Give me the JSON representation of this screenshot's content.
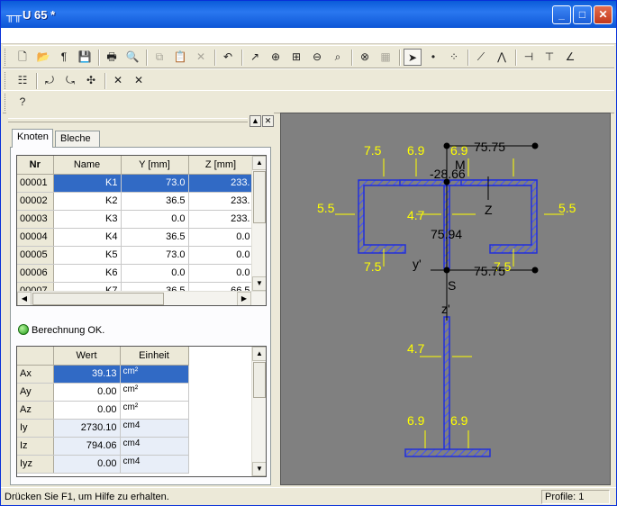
{
  "window": {
    "title": "U 65 *",
    "app_icon": "╥╥"
  },
  "toolbar1": [
    {
      "name": "new-icon",
      "glyph": "🗋"
    },
    {
      "name": "open-icon",
      "glyph": "📂"
    },
    {
      "name": "import-icon",
      "glyph": "¶"
    },
    {
      "name": "save-icon",
      "glyph": "💾"
    },
    {
      "name": "print-icon",
      "glyph": "🖶"
    },
    {
      "name": "print-preview-icon",
      "glyph": "🔍"
    },
    {
      "name": "copy-icon",
      "glyph": "⧉"
    },
    {
      "name": "paste-icon",
      "glyph": "📋"
    },
    {
      "name": "delete-icon",
      "glyph": "✕"
    },
    {
      "name": "undo-icon",
      "glyph": "↶"
    },
    {
      "name": "arrow-icon",
      "glyph": "↗"
    },
    {
      "name": "zoom-in-icon",
      "glyph": "⊕"
    },
    {
      "name": "zoom-window-icon",
      "glyph": "⊞"
    },
    {
      "name": "zoom-out-icon",
      "glyph": "⊖"
    },
    {
      "name": "zoom-fit-icon",
      "glyph": "⌕"
    },
    {
      "name": "zoom-select-icon",
      "glyph": "⊗"
    },
    {
      "name": "grid-view-icon",
      "glyph": "▦"
    },
    {
      "name": "select-pointer-icon",
      "glyph": "➤"
    },
    {
      "name": "node-icon",
      "glyph": "•"
    },
    {
      "name": "dot-grid-icon",
      "glyph": "⁘"
    },
    {
      "name": "line-icon",
      "glyph": "⟋"
    },
    {
      "name": "polyline-icon",
      "glyph": "⋀"
    },
    {
      "name": "dimension-h-icon",
      "glyph": "⊣"
    },
    {
      "name": "dimension-v-icon",
      "glyph": "⊤"
    },
    {
      "name": "dimension-angle-icon",
      "glyph": "∠"
    }
  ],
  "toolbar2": [
    {
      "name": "properties-icon",
      "glyph": "☷"
    },
    {
      "name": "rotate-icon",
      "glyph": "⤾"
    },
    {
      "name": "mirror-icon",
      "glyph": "⤿"
    },
    {
      "name": "move-icon",
      "glyph": "✣"
    },
    {
      "name": "delete-cross-icon",
      "glyph": "✕"
    },
    {
      "name": "delete-all-icon",
      "glyph": "✕"
    }
  ],
  "toolbar3": [
    {
      "name": "help-icon",
      "glyph": "?"
    }
  ],
  "tabs": [
    "Knoten",
    "Bleche"
  ],
  "nodes_table": {
    "headers": [
      "Nr",
      "Name",
      "Y [mm]",
      "Z [mm]"
    ],
    "rows": [
      [
        "00001",
        "K1",
        "73.0",
        "233."
      ],
      [
        "00002",
        "K2",
        "36.5",
        "233."
      ],
      [
        "00003",
        "K3",
        "0.0",
        "233."
      ],
      [
        "00004",
        "K4",
        "36.5",
        "0.0"
      ],
      [
        "00005",
        "K5",
        "73.0",
        "0.0"
      ],
      [
        "00006",
        "K6",
        "0.0",
        "0.0"
      ],
      [
        "00007",
        "K7",
        "36.5",
        "66.5"
      ]
    ]
  },
  "calc_status": "Berechnung OK.",
  "results_table": {
    "headers": [
      "",
      "Wert",
      "Einheit"
    ],
    "rows": [
      [
        "Ax",
        "39.13",
        "cm²"
      ],
      [
        "Ay",
        "0.00",
        "cm²"
      ],
      [
        "Az",
        "0.00",
        "cm²"
      ],
      [
        "Iy",
        "2730.10",
        "cm4"
      ],
      [
        "Iz",
        "794.06",
        "cm4"
      ],
      [
        "Iyz",
        "0.00",
        "cm4"
      ]
    ]
  },
  "drawing": {
    "dims": {
      "top_left": "7.5",
      "top_mid_left": "6.9",
      "top_mid_right": "6.9",
      "top_width": "75.75",
      "m_offset": "-28.66",
      "m_label": "M",
      "z_axis": "Z",
      "left_thk": "5.5",
      "right_thk": "5.5",
      "web_thk": "4.7",
      "web_height": "75.94",
      "bottom_left": "7.5",
      "bottom_right": "7.5",
      "y_prime": "y'",
      "bottom_width": "75.75",
      "s_label": "S",
      "z_prime": "z'",
      "lower_web_thk": "4.7",
      "lower_left": "6.9",
      "lower_right": "6.9"
    },
    "colors": {
      "section": "#2231d8",
      "hatch": "#3f4fff",
      "dim": "#ffff00",
      "background": "#808080"
    }
  },
  "statusbar": {
    "message": "Drücken Sie F1, um Hilfe zu erhalten.",
    "profile": "Profile: 1"
  }
}
